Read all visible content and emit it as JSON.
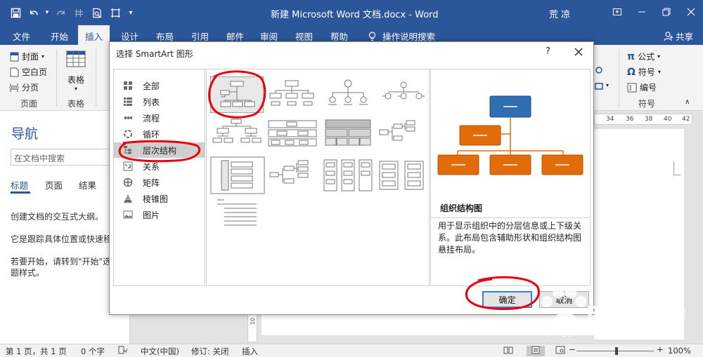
{
  "window": {
    "title": "新建 Microsoft Word 文档.docx  -  Word",
    "user": "荒 凉"
  },
  "ribbon_tabs": [
    "文件",
    "开始",
    "插入",
    "设计",
    "布局",
    "引用",
    "邮件",
    "审阅",
    "视图",
    "帮助"
  ],
  "tell_me": "操作说明搜索",
  "share": "共享",
  "ribbon": {
    "pages_group": {
      "cover": "封面",
      "blank": "空白页",
      "break": "分页",
      "label": "页面"
    },
    "table_group": {
      "table": "表格",
      "label": "表格"
    },
    "symbols_group": {
      "equation": "公式",
      "symbol": "符号",
      "numbering": "编号",
      "label": "符号"
    }
  },
  "navigation": {
    "title": "导航",
    "search_placeholder": "在文档中搜索",
    "tabs": [
      "标题",
      "页面",
      "结果"
    ],
    "text1": "创建文档的交互式大纲。",
    "text2": "它是跟踪具体位置或快速移",
    "text3": "若要开始，请转到\"开始\"选",
    "text4": "题样式。"
  },
  "ruler": [
    "34",
    "36",
    "38",
    "40",
    "42"
  ],
  "vruler": "10",
  "dialog": {
    "title": "选择 SmartArt 图形",
    "help": "?",
    "categories": [
      "全部",
      "列表",
      "流程",
      "循环",
      "层次结构",
      "关系",
      "矩阵",
      "棱锥图",
      "图片"
    ],
    "selected_category": "层次结构",
    "preview_name": "组织结构图",
    "preview_desc": "用于显示组织中的分层信息或上下级关系。此布局包含辅助形状和组织结构图悬挂布局。",
    "ok": "确定",
    "cancel": "取消"
  },
  "statusbar": {
    "page": "第 1 页，共 1 页",
    "words": "0 个字",
    "lang": "中文(中国)",
    "track": "修订: 关闭",
    "mode": "插入",
    "zoom": "100%"
  },
  "watermark": {
    "url": "jingyan.baidu.com"
  },
  "colors": {
    "word_blue": "#2b579a",
    "annotation_red": "#e8000b",
    "preview_blue": "#2f6eb5",
    "preview_orange": "#e36c0a"
  }
}
